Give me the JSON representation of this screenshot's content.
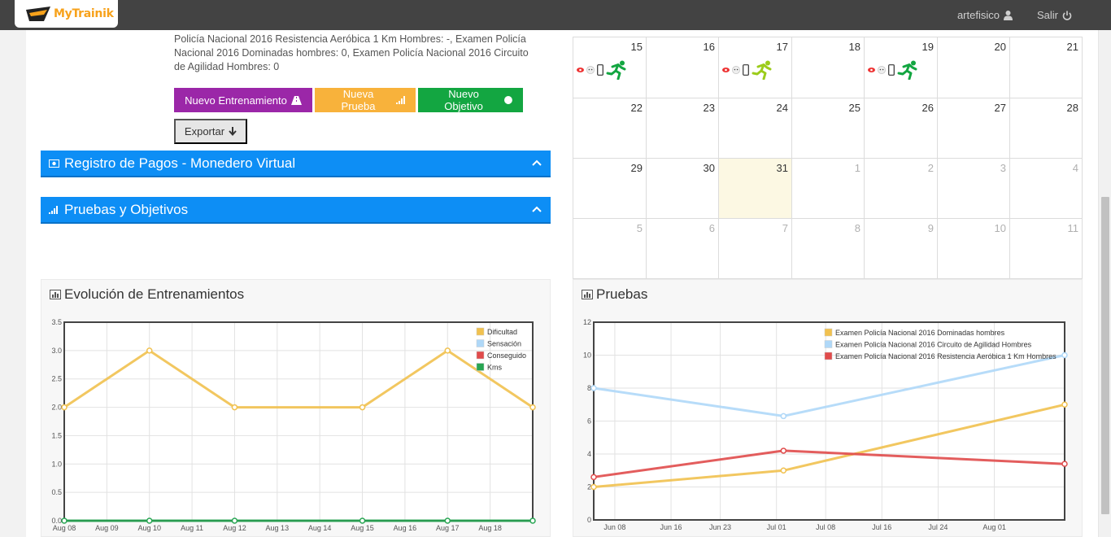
{
  "header": {
    "logo_text": "MyTrainik",
    "username": "artefisico",
    "logout_label": "Salir",
    "bar_color": "#434343"
  },
  "info": {
    "text": "Policía Nacional 2016 Resistencia Aeróbica 1 Km Hombres: -, Examen Policía Nacional 2016 Dominadas hombres: 0, Examen Policía Nacional 2016 Circuito de Agilidad Hombres: 0"
  },
  "actions": {
    "new_training": "Nuevo Entrenamiento",
    "new_test": "Nueva Prueba",
    "new_goal": "Nuevo Objetivo",
    "export": "Exportar"
  },
  "panels": {
    "payments": "Registro de Pagos - Monedero Virtual",
    "tests_goals": "Pruebas y Objetivos"
  },
  "calendar": {
    "rows": [
      [
        {
          "d": "15",
          "m": false,
          "evt": true
        },
        {
          "d": "16",
          "m": false
        },
        {
          "d": "17",
          "m": false,
          "evt": true
        },
        {
          "d": "18",
          "m": false
        },
        {
          "d": "19",
          "m": false,
          "evt": true
        },
        {
          "d": "20",
          "m": false
        },
        {
          "d": "21",
          "m": false
        }
      ],
      [
        {
          "d": "22",
          "m": false
        },
        {
          "d": "23",
          "m": false
        },
        {
          "d": "24",
          "m": false
        },
        {
          "d": "25",
          "m": false
        },
        {
          "d": "26",
          "m": false
        },
        {
          "d": "27",
          "m": false
        },
        {
          "d": "28",
          "m": false
        }
      ],
      [
        {
          "d": "29",
          "m": false
        },
        {
          "d": "30",
          "m": false
        },
        {
          "d": "31",
          "m": false,
          "today": true
        },
        {
          "d": "1",
          "m": true
        },
        {
          "d": "2",
          "m": true
        },
        {
          "d": "3",
          "m": true
        },
        {
          "d": "4",
          "m": true
        }
      ],
      [
        {
          "d": "5",
          "m": true
        },
        {
          "d": "6",
          "m": true
        },
        {
          "d": "7",
          "m": true
        },
        {
          "d": "8",
          "m": true
        },
        {
          "d": "9",
          "m": true
        },
        {
          "d": "10",
          "m": true
        },
        {
          "d": "11",
          "m": true
        }
      ]
    ],
    "event_icon": "runner-icon"
  },
  "charts": {
    "training_title": "Evolución de Entrenamientos",
    "tests_title": "Pruebas"
  },
  "chart_data": [
    {
      "type": "line",
      "x": [
        "Aug 08",
        "Aug 10",
        "Aug 12",
        "Aug 15",
        "Aug 17",
        "Aug 19"
      ],
      "xticks": [
        "Aug 08",
        "Aug 09",
        "Aug 10",
        "Aug 11",
        "Aug 12",
        "Aug 13",
        "Aug 14",
        "Aug 15",
        "Aug 16",
        "Aug 17",
        "Aug 18"
      ],
      "yticks": [
        "0.0",
        "0.5",
        "1.0",
        "1.5",
        "2.0",
        "2.5",
        "3.0",
        "3.5"
      ],
      "ylim": [
        0,
        3.5
      ],
      "series": [
        {
          "name": "Dificultad",
          "color": "#f1c14f",
          "values": [
            2,
            3,
            2,
            2,
            3,
            2
          ]
        },
        {
          "name": "Sensación",
          "color": "#afd8f8",
          "values": []
        },
        {
          "name": "Conseguido",
          "color": "#e04b4b",
          "values": []
        },
        {
          "name": "Kms",
          "color": "#27a552",
          "values": [
            0,
            0,
            0,
            0,
            0,
            0
          ]
        }
      ],
      "legend_position": "top-right",
      "grid": true
    },
    {
      "type": "line",
      "xticks": [
        "Jun 08",
        "Jun 16",
        "Jun 23",
        "Jul 01",
        "Jul 08",
        "Jul 16",
        "Jul 24",
        "Aug 01"
      ],
      "yticks": [
        "0",
        "2",
        "4",
        "6",
        "8",
        "10",
        "12"
      ],
      "ylim": [
        0,
        12
      ],
      "series": [
        {
          "name": "Examen Policía Nacional 2016 Dominadas hombres",
          "color": "#f1c14f",
          "x": [
            "Jun 05",
            "Jul 02",
            "Aug 11"
          ],
          "values": [
            2,
            3,
            7
          ]
        },
        {
          "name": "Examen Policía Nacional 2016 Circuito de Agilidad Hombres",
          "color": "#afd8f8",
          "x": [
            "Jun 05",
            "Jul 02",
            "Aug 11"
          ],
          "values": [
            8,
            6.3,
            10
          ]
        },
        {
          "name": "Examen Policía Nacional 2016 Resistencia Aeróbica 1 Km Hombres",
          "color": "#e04b4b",
          "x": [
            "Jun 05",
            "Jul 02",
            "Aug 11"
          ],
          "values": [
            2.6,
            4.2,
            3.4
          ]
        }
      ],
      "legend_position": "top-right",
      "grid": true
    }
  ]
}
